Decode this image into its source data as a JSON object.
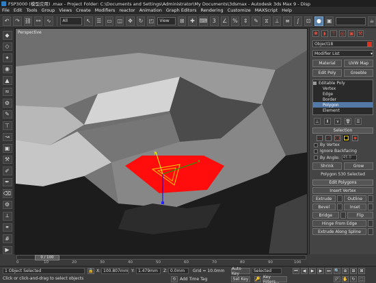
{
  "window": {
    "title": "FSP3000 (模型应用) .max - Project Folder: C:\\Documents and Settings\\Administrator\\My Documents\\3dsmax - Autodesk 3ds Max 9 - Disp"
  },
  "menu": [
    "File",
    "Edit",
    "Tools",
    "Group",
    "Views",
    "Create",
    "Modifiers",
    "reactor",
    "Animation",
    "Graph Editors",
    "Rendering",
    "Customize",
    "MAXScript",
    "Help"
  ],
  "toolbar": {
    "selection_filter": "All",
    "reference_coord": "View"
  },
  "viewport": {
    "label": "Perspective"
  },
  "command_panel": {
    "object_name": "Object18",
    "object_color": "#dd3322",
    "modifier_list_label": "Modifier List",
    "buttons": [
      "Material",
      "UVW Map",
      "Edit Poly",
      "Greeble"
    ],
    "stack": {
      "root": "Editable Poly",
      "subs": [
        "Vertex",
        "Edge",
        "Border",
        "Polygon",
        "Element"
      ],
      "selected_index": 3
    },
    "selection": {
      "title": "Selection",
      "by_vertex": "By Vertex",
      "ignore_backfacing": "Ignore Backfacing",
      "by_angle": "By Angle:",
      "by_angle_value": "45.0",
      "shrink": "Shrink",
      "grow": "Grow",
      "info": "Polygon 530 Selected"
    },
    "edit_polygons": {
      "title": "Edit Polygons",
      "insert_vertex": "Insert Vertex",
      "extrude": "Extrude",
      "outline": "Outline",
      "bevel": "Bevel",
      "inset": "Inset",
      "bridge": "Bridge",
      "flip": "Flip",
      "hinge_from_edge": "Hinge From Edge",
      "extrude_along_spline": "Extrude Along Spline"
    }
  },
  "timeline": {
    "frame": "0 / 100",
    "ticks": [
      "0",
      "10",
      "20",
      "30",
      "40",
      "50",
      "60",
      "70",
      "80",
      "90",
      "100"
    ]
  },
  "status": {
    "selected": "1 Object Selected",
    "prompt": "Click or click-and-drag to select objects",
    "x_label": "X:",
    "x_value": "100.807mm",
    "y_label": "Y:",
    "y_value": "1.479mm",
    "z_label": "Z:",
    "z_value": "0.0mm",
    "grid": "Grid = 10.0mm",
    "add_time_tag": "Add Time Tag",
    "auto_key": "Auto Key",
    "set_key": "Set Key",
    "key_mode": "Selected",
    "key_filters": "Key Filters..."
  }
}
